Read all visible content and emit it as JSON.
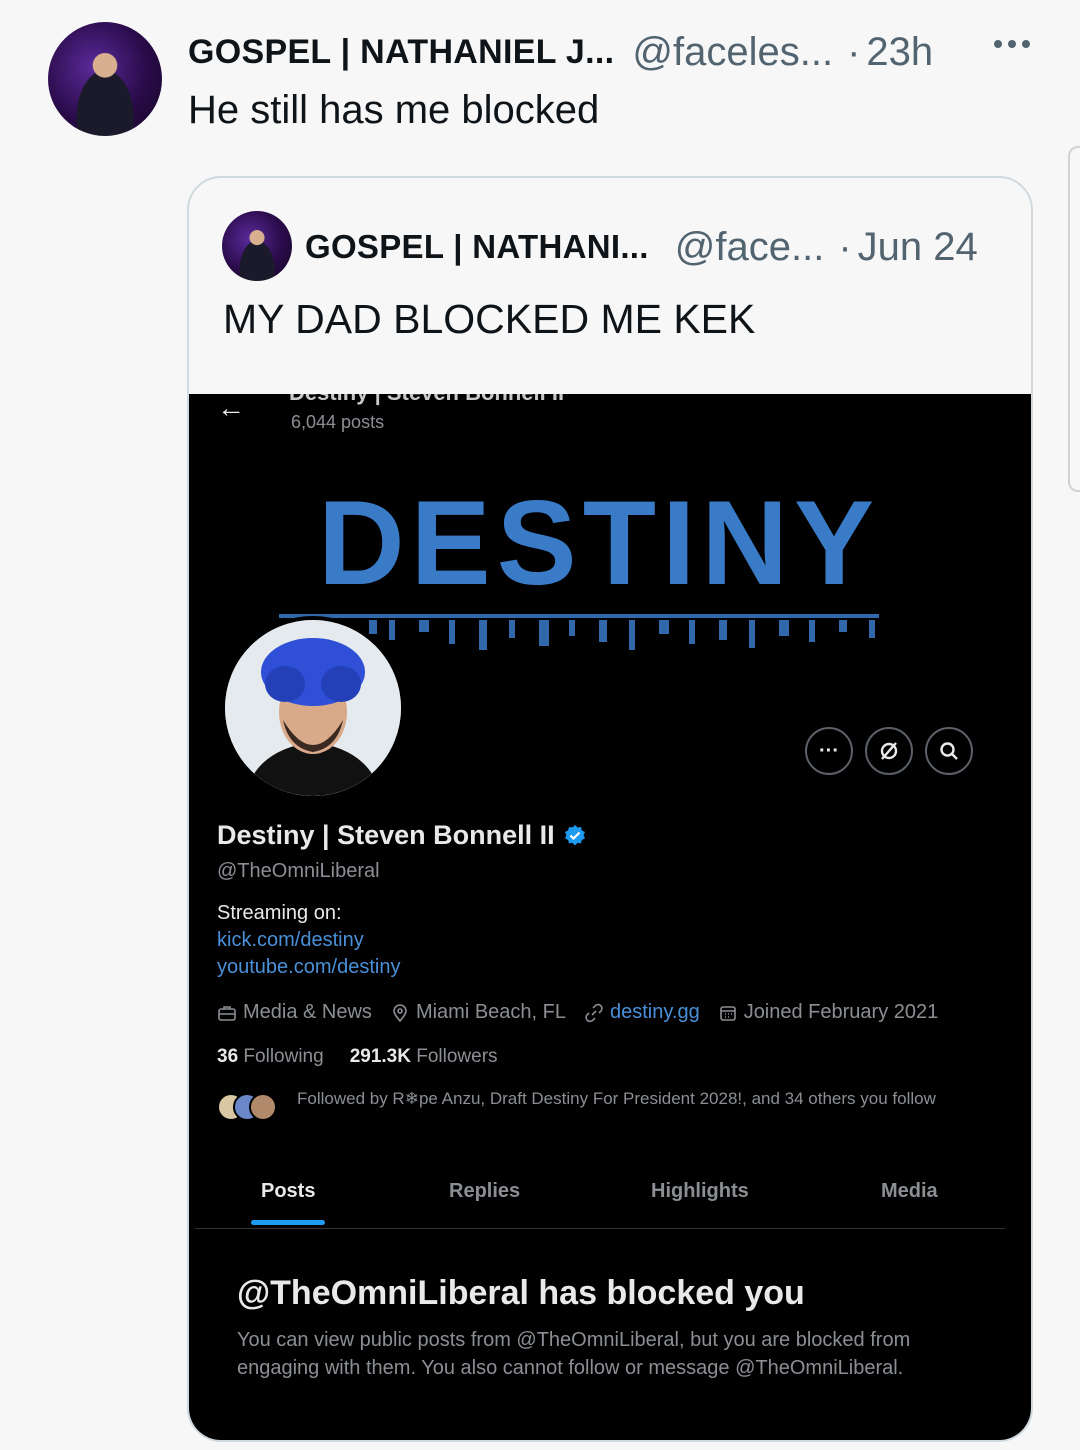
{
  "tweet": {
    "author_name": "GOSPEL | NATHANIEL J...",
    "handle": "@faceles...",
    "separator": "·",
    "time": "23h",
    "text": "He still has me blocked"
  },
  "quoted_tweet": {
    "author_name": "GOSPEL | NATHANI...",
    "handle": "@face...",
    "separator": "·",
    "time": "Jun 24",
    "text": "MY DAD BLOCKED ME KEK"
  },
  "profile_screenshot": {
    "top_name_cut": "Destiny | Steven Bonnell II",
    "posts_count": "6,044 posts",
    "banner_text": "DESTINY",
    "display_name": "Destiny | Steven Bonnell II",
    "handle": "@TheOmniLiberal",
    "bio_title": "Streaming on:",
    "bio_link_1": "kick.com/destiny",
    "bio_link_2": "youtube.com/destiny",
    "category": "Media & News",
    "location": "Miami Beach, FL",
    "website": "destiny.gg",
    "joined": "Joined February 2021",
    "following_count": "36",
    "following_label": "Following",
    "followers_count": "291.3K",
    "followers_label": "Followers",
    "followed_by": "Followed by R❄pe Anzu, Draft Destiny For President 2028!, and 34 others you follow",
    "tabs": [
      "Posts",
      "Replies",
      "Highlights",
      "Media"
    ],
    "active_tab": "Posts",
    "blocked_title": "@TheOmniLiberal has blocked you",
    "blocked_desc": "You can view public posts from @TheOmniLiberal, but you are blocked from engaging with them. You also cannot follow or message @TheOmniLiberal.",
    "action_more": "···",
    "colors": {
      "accent": "#1d9bf0",
      "link": "#4a90d9",
      "banner_blue": "#3a7bc8"
    }
  }
}
